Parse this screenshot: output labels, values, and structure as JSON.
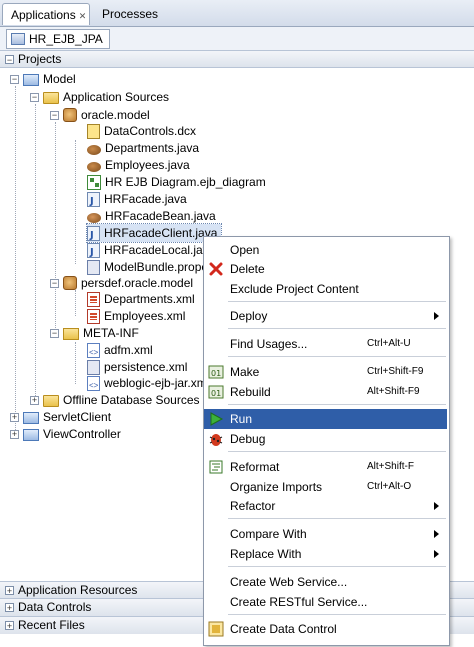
{
  "tabs": {
    "applications": "Applications",
    "processes": "Processes"
  },
  "app_selector": "HR_EJB_JPA",
  "projects_header": "Projects",
  "tree": {
    "model": "Model",
    "application_sources": "Application Sources",
    "oracle_model": "oracle.model",
    "datacontrols": "DataControls.dcx",
    "departments_java": "Departments.java",
    "employees_java": "Employees.java",
    "hr_ejb_diagram": "HR EJB Diagram.ejb_diagram",
    "hrfacade": "HRFacade.java",
    "hrfacadebean": "HRFacadeBean.java",
    "hrfacadeclient": "HRFacadeClient.java",
    "hrfacadelocal": "HRFacadeLocal.java",
    "modelbundle": "ModelBundle.proper",
    "persdef": "persdef.oracle.model",
    "departments_xml": "Departments.xml",
    "employees_xml": "Employees.xml",
    "meta_inf": "META-INF",
    "adfm": "adfm.xml",
    "persistence": "persistence.xml",
    "weblogic": "weblogic-ejb-jar.xml",
    "offline_db": "Offline Database Sources",
    "servletclient": "ServletClient",
    "viewcontroller": "ViewController"
  },
  "accordions": {
    "app_resources": "Application Resources",
    "data_controls": "Data Controls",
    "recent_files": "Recent Files"
  },
  "context_menu": {
    "open": "Open",
    "delete": "Delete",
    "exclude": "Exclude Project Content",
    "deploy": "Deploy",
    "find_usages": "Find Usages...",
    "find_usages_sc": "Ctrl+Alt-U",
    "make": "Make",
    "make_sc": "Ctrl+Shift-F9",
    "rebuild": "Rebuild",
    "rebuild_sc": "Alt+Shift-F9",
    "run": "Run",
    "debug": "Debug",
    "reformat": "Reformat",
    "reformat_sc": "Alt+Shift-F",
    "organize_imports": "Organize Imports",
    "organize_imports_sc": "Ctrl+Alt-O",
    "refactor": "Refactor",
    "compare_with": "Compare With",
    "replace_with": "Replace With",
    "create_web_service": "Create Web Service...",
    "create_restful": "Create RESTful Service...",
    "create_data_control": "Create Data Control"
  },
  "colors": {
    "highlight": "#2f5ea8",
    "selection": "#d7e3f4",
    "tab_bar": "#d3dcea"
  }
}
